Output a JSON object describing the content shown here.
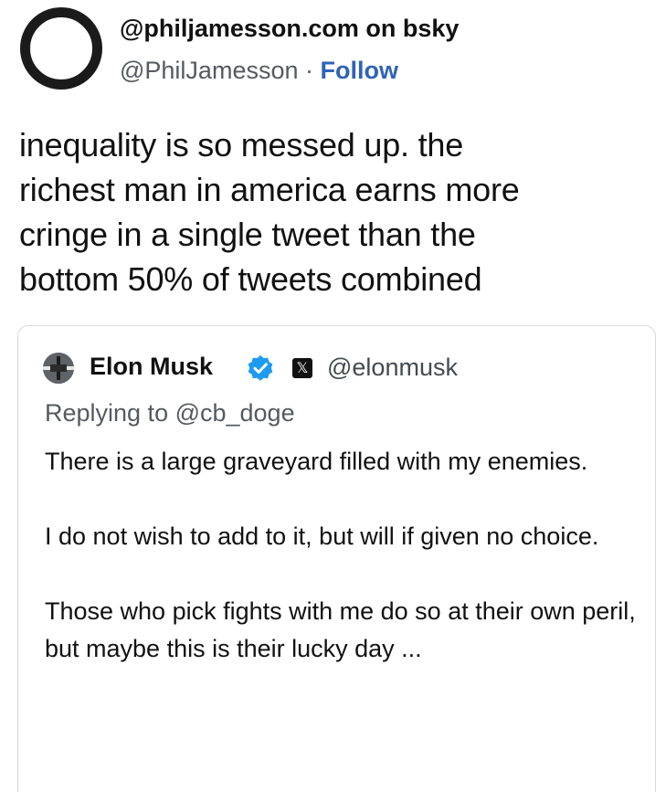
{
  "post": {
    "display_name": "@philjamesson.com on bsky",
    "handle": "@PhilJamesson",
    "separator": " · ",
    "follow_label": "Follow",
    "text": "inequality is so messed up. the\nrichest man in america earns more\ncringe in a single tweet than the\nbottom 50% of tweets combined"
  },
  "quote": {
    "name": "Elon Musk",
    "verified_icon": "verified-badge-icon",
    "platform_icon": "x-logo-icon",
    "platform_glyph": "𝕏",
    "handle": "@elonmusk",
    "replying_to": "Replying to @cb_doge",
    "paragraphs": [
      "There is a large graveyard filled with my enemies.",
      "I do not wish to add to it, but will if given no choice.",
      "Those who pick fights with me do so at their own peril, but maybe this is their lucky day ..."
    ]
  },
  "colors": {
    "follow": "#2f63b8",
    "verified": "#1d9bf0",
    "muted_text": "#555a60",
    "card_border": "#d6d9dc"
  }
}
